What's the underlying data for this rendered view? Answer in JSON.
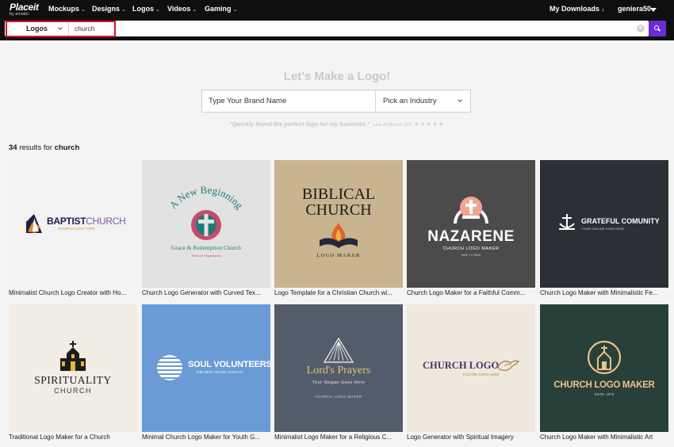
{
  "nav": {
    "logo": "Placeit",
    "logo_sub": "by envato",
    "items": [
      "Mockups",
      "Designs",
      "Logos",
      "Videos",
      "Gaming"
    ],
    "my_downloads": "My Downloads",
    "username": "geniera50"
  },
  "search": {
    "category": "Logos",
    "query": "church"
  },
  "hero": {
    "title": "Let's Make a Logo!",
    "brand_placeholder": "Type Your Brand Name",
    "industry_placeholder": "Pick an Industry",
    "testimonial": "\"Quickly found the perfect logo for my business.\"",
    "testimonial_author": "Lee Andrews 5/5",
    "stars": "★★★★★"
  },
  "results": {
    "count": "34",
    "label": "results for",
    "term": "church"
  },
  "cards": [
    {
      "caption": "Minimalist Church Logo Creator with Ho...",
      "bg": "#f2f2f2",
      "art": {
        "line1": "BAPTIST",
        "line2": "CHURCH",
        "tag": "CHURCH LOGO TYPE"
      }
    },
    {
      "caption": "Church Logo Generator with Curved Tex...",
      "bg": "#e2e2e2",
      "art": {
        "arc": "A New Beginning",
        "line1": "Grace & Redemption Church",
        "line2": "Advocate Organization"
      }
    },
    {
      "caption": "Logo Template for a Christian Church wi...",
      "bg": "#c8b48e",
      "art": {
        "line1": "BIBLICAL",
        "line2": "CHURCH",
        "line3": "LOGO MAKER"
      }
    },
    {
      "caption": "Church Logo Maker for a Faithful Comm...",
      "bg": "#4b4b4b",
      "art": {
        "line1": "NAZARENE",
        "line2": "CHURCH LOGO MAKER",
        "line3": "SAVE TO SAVE"
      }
    },
    {
      "caption": "Church Logo Maker with Minimalistic Fe...",
      "bg": "#2b2f36",
      "art": {
        "line1": "GRATEFUL COMUNITY",
        "line2": "YOUR TAGLINE GOES HERE"
      }
    },
    {
      "caption": "Traditional Logo Maker for a Church",
      "bg": "#f1ede4",
      "art": {
        "line1": "SPIRITUALITY",
        "line2": "CHURCH"
      }
    },
    {
      "caption": "Minimal Church Logo Maker for Youth G...",
      "bg": "#6b9bd6",
      "art": {
        "line1": "SOUL VOLUNTEERS",
        "line2": "THE NEW YOUNG CHURCH"
      }
    },
    {
      "caption": "Minimalist Logo Maker for a Religious C...",
      "bg": "#535c6b",
      "art": {
        "line1": "Lord's Prayers",
        "line2": "Your Slogan Goes Here",
        "line3": "CHURCH LOGO MAKER"
      }
    },
    {
      "caption": "Logo Generator with Spiritual Imagery",
      "bg": "#efe8dc",
      "art": {
        "line1": "CHURCH LOGO",
        "line2": "TAGLINE GOES HERE"
      }
    },
    {
      "caption": "Church Logo Maker with Minimalistic Art",
      "bg": "#27403a",
      "art": {
        "line1": "CHURCH LOGO MAKER",
        "line2": "ESTD. 1975"
      }
    }
  ]
}
